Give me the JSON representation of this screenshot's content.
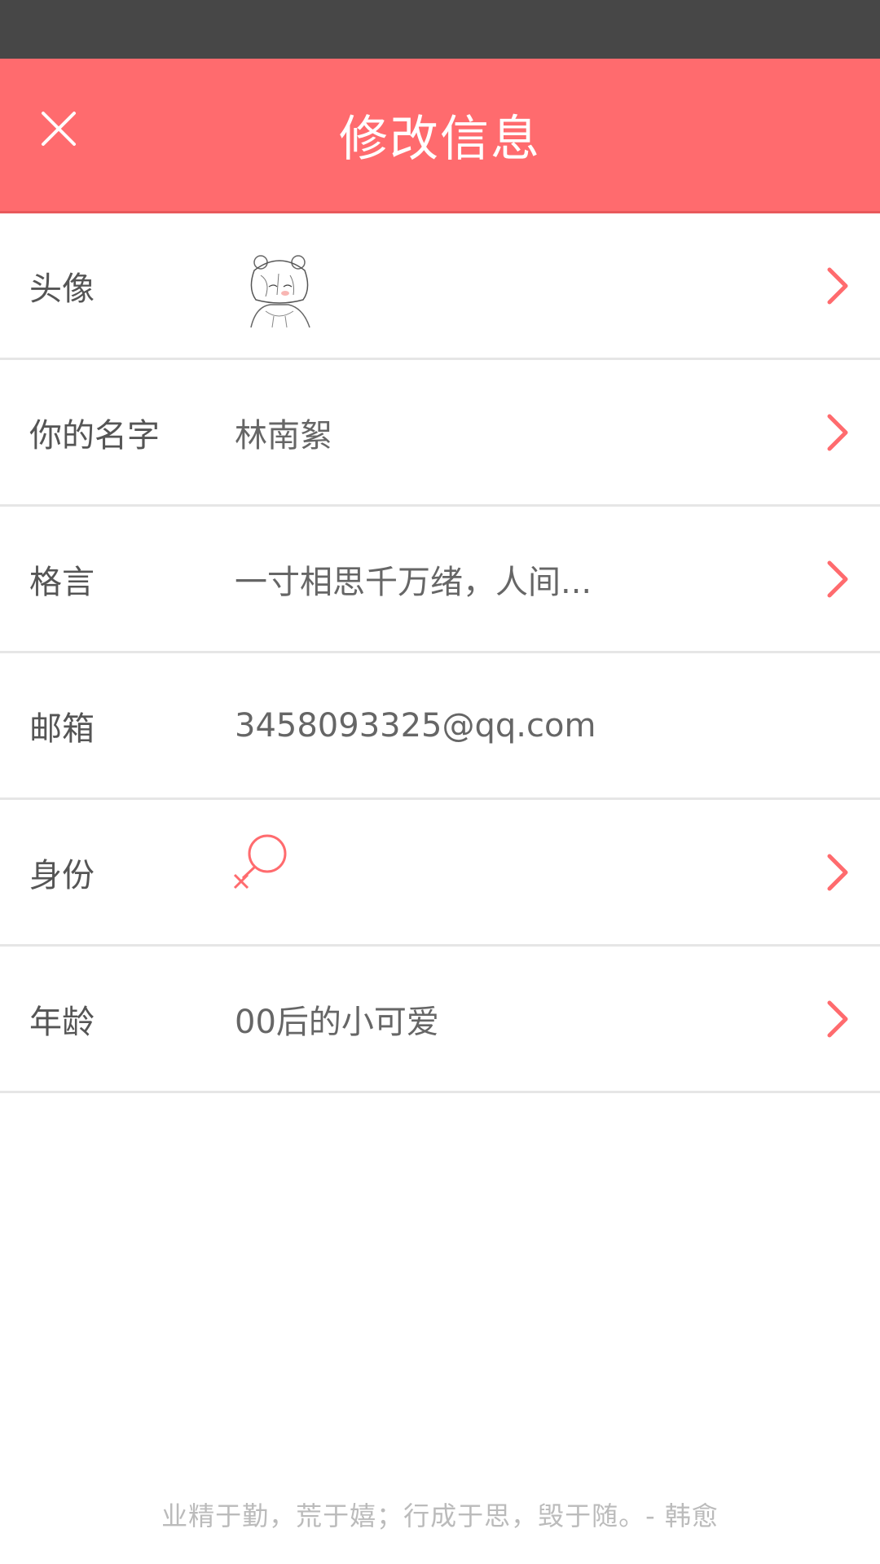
{
  "status_bar": {},
  "header": {
    "title": "修改信息",
    "close_icon": "close-icon"
  },
  "rows": [
    {
      "label": "头像",
      "type": "avatar",
      "icon": "avatar-image",
      "has_chevron": true
    },
    {
      "label": "你的名字",
      "value": "林南絮",
      "has_chevron": true
    },
    {
      "label": "格言",
      "value": "一寸相思千万绪，人间...",
      "has_chevron": true
    },
    {
      "label": "邮箱",
      "value": "3458093325@qq.com",
      "has_chevron": false
    },
    {
      "label": "身份",
      "type": "gender",
      "icon": "female-icon",
      "has_chevron": true
    },
    {
      "label": "年龄",
      "value": "00后的小可爱",
      "has_chevron": true
    }
  ],
  "footer": {
    "quote": "业精于勤，荒于嬉；行成于思，毁于随。- 韩愈"
  },
  "colors": {
    "accent": "#FF6B6E",
    "status_bar": "#474747",
    "divider": "#E6E6E6"
  }
}
